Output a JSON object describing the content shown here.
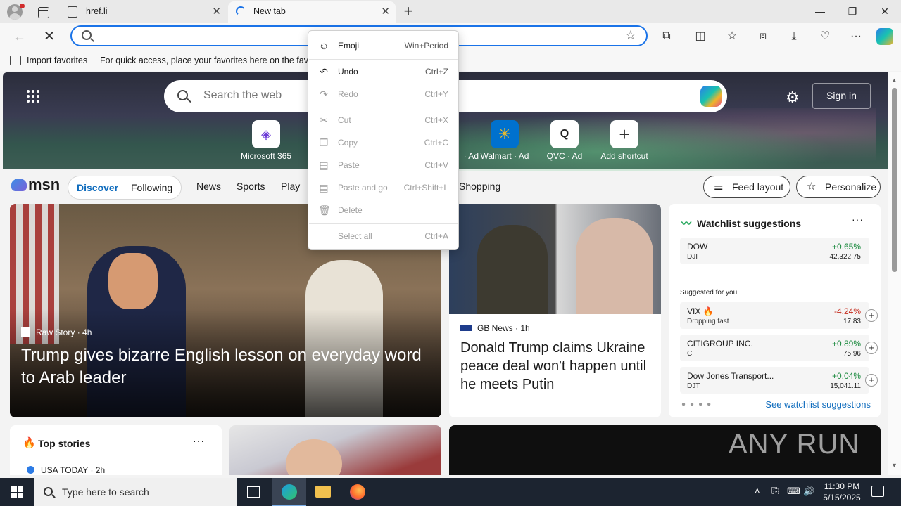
{
  "browser": {
    "tabs": [
      {
        "title": "href.li",
        "close": "✕"
      },
      {
        "title": "New tab",
        "close": "✕"
      }
    ],
    "new_tab": "+",
    "window_controls": {
      "minimize": "—",
      "maximize": "❐",
      "close": "✕"
    },
    "address": {
      "value": "",
      "placeholder": ""
    },
    "favorites_bar": {
      "import_label": "Import favorites",
      "hint": "For quick access, place your favorites here on the favorites bar."
    }
  },
  "ntp": {
    "search_placeholder": "Search the web",
    "signin_label": "Sign in",
    "shortcuts": [
      {
        "label": "Microsoft 365",
        "icon": "microsoft365-icon",
        "glyph": "◈"
      },
      {
        "label": "· Ad",
        "icon": "ad-icon",
        "glyph": ""
      },
      {
        "label": "Walmart · Ad",
        "icon": "walmart-icon",
        "glyph": "✳"
      },
      {
        "label": "QVC · Ad",
        "icon": "qvc-icon",
        "glyph": "Q"
      },
      {
        "label": "Add shortcut",
        "icon": "plus-icon",
        "glyph": "+"
      }
    ],
    "msn": {
      "logo": "msn",
      "tabs": [
        "Discover",
        "Following"
      ],
      "categories": [
        "News",
        "Sports",
        "Play",
        "Shopping"
      ],
      "feed_layout": "Feed layout",
      "personalize": "Personalize"
    },
    "stories": {
      "hero": {
        "source": "Raw Story",
        "age": "· 4h",
        "headline": "Trump gives bizarre English lesson on everyday word to Arab leader"
      },
      "second": {
        "source": "GB News",
        "age": "· 1h",
        "headline": "Donald Trump claims Ukraine peace deal won't happen until he meets Putin"
      }
    },
    "watchlist": {
      "title": "Watchlist suggestions",
      "more": "···",
      "top": {
        "name": "DOW",
        "symbol": "DJI",
        "change": "+0.65%",
        "price": "42,322.75"
      },
      "suggested_label": "Suggested for you",
      "suggestions": [
        {
          "name": "VIX",
          "symbol": "Dropping fast",
          "change": "-4.24%",
          "price": "17.83",
          "trend": "neg"
        },
        {
          "name": "CITIGROUP INC.",
          "symbol": "C",
          "change": "+0.89%",
          "price": "75.96",
          "trend": "pos"
        },
        {
          "name": "Dow Jones Transport...",
          "symbol": "DJT",
          "change": "+0.04%",
          "price": "15,041.11",
          "trend": "pos"
        }
      ],
      "see_more": "See watchlist suggestions"
    },
    "top_stories": {
      "title": "Top stories",
      "more": "···",
      "source": "USA TODAY · 2h"
    },
    "watermark": "ANY RUN"
  },
  "context_menu": {
    "items": [
      {
        "label": "Emoji",
        "shortcut": "Win+Period",
        "icon": "emoji-icon",
        "glyph": "☺",
        "enabled": true
      },
      {
        "label": "Undo",
        "shortcut": "Ctrl+Z",
        "icon": "undo-icon",
        "glyph": "↶",
        "enabled": true
      },
      {
        "label": "Redo",
        "shortcut": "Ctrl+Y",
        "icon": "redo-icon",
        "glyph": "↷",
        "enabled": false
      },
      {
        "label": "Cut",
        "shortcut": "Ctrl+X",
        "icon": "cut-icon",
        "glyph": "✂",
        "enabled": false
      },
      {
        "label": "Copy",
        "shortcut": "Ctrl+C",
        "icon": "copy-icon",
        "glyph": "❐",
        "enabled": false
      },
      {
        "label": "Paste",
        "shortcut": "Ctrl+V",
        "icon": "paste-icon",
        "glyph": "▤",
        "enabled": false
      },
      {
        "label": "Paste and go",
        "shortcut": "Ctrl+Shift+L",
        "icon": "paste-go-icon",
        "glyph": "▤",
        "enabled": false
      },
      {
        "label": "Delete",
        "shortcut": "",
        "icon": "delete-icon",
        "glyph": "🗑",
        "enabled": false
      },
      {
        "label": "Select all",
        "shortcut": "Ctrl+A",
        "icon": "",
        "glyph": "",
        "enabled": false
      }
    ]
  },
  "taskbar": {
    "search_placeholder": "Type here to search",
    "time": "11:30 PM",
    "date": "5/15/2025"
  },
  "colors": {
    "accent": "#1a73e8",
    "positive": "#1c8a3f",
    "negative": "#c42b1c",
    "link": "#0f6cbd"
  }
}
